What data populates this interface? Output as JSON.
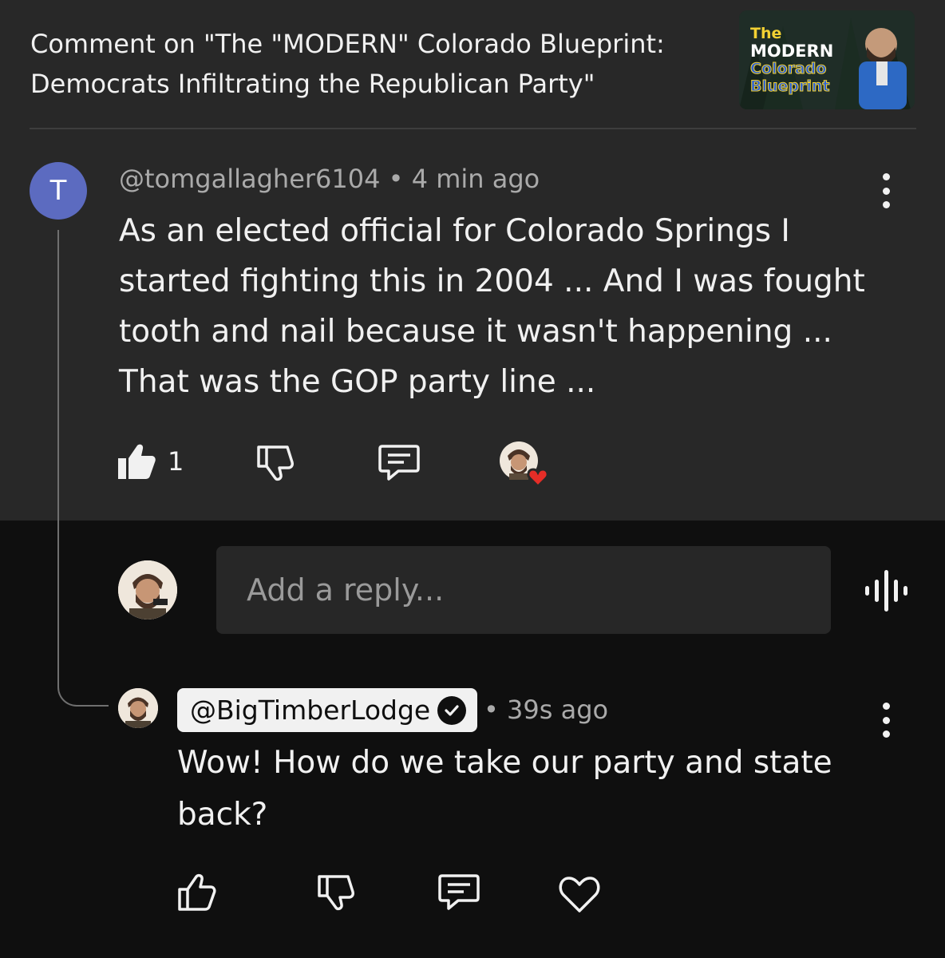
{
  "header": {
    "title": "Comment on \"The \"MODERN\" Colorado Blueprint: Democrats Infiltrating the Republican Party\"",
    "thumbnail": {
      "line1": "The",
      "line2": "MODERN",
      "line3": "Colorado",
      "line4": "Blueprint"
    }
  },
  "comment": {
    "avatar_letter": "T",
    "handle": "@tomgallagher6104",
    "separator": " • ",
    "time": "4 min ago",
    "text": "As an elected official for Colorado Springs I started fighting this in 2004 ... And I was fought tooth and nail because it wasn't happening ... That was the GOP party line ...",
    "like_count": "1",
    "hearted": true
  },
  "reply_box": {
    "placeholder": "Add a reply..."
  },
  "reply": {
    "handle": "@BigTimberLodge",
    "verified": true,
    "separator": "• ",
    "time": "39s ago",
    "text": "Wow!  How do we take our party and state back?"
  },
  "colors": {
    "top_bg": "#282828",
    "bottom_bg": "#0f0f0f",
    "avatar_t": "#5c6bc0",
    "heart": "#e52d27"
  },
  "icons": [
    "thumbs-up-filled-icon",
    "thumbs-down-icon",
    "reply-icon",
    "creator-heart-icon",
    "voice-search-icon",
    "more-vert-icon",
    "verified-check-icon",
    "thumbs-up-icon",
    "heart-icon"
  ]
}
